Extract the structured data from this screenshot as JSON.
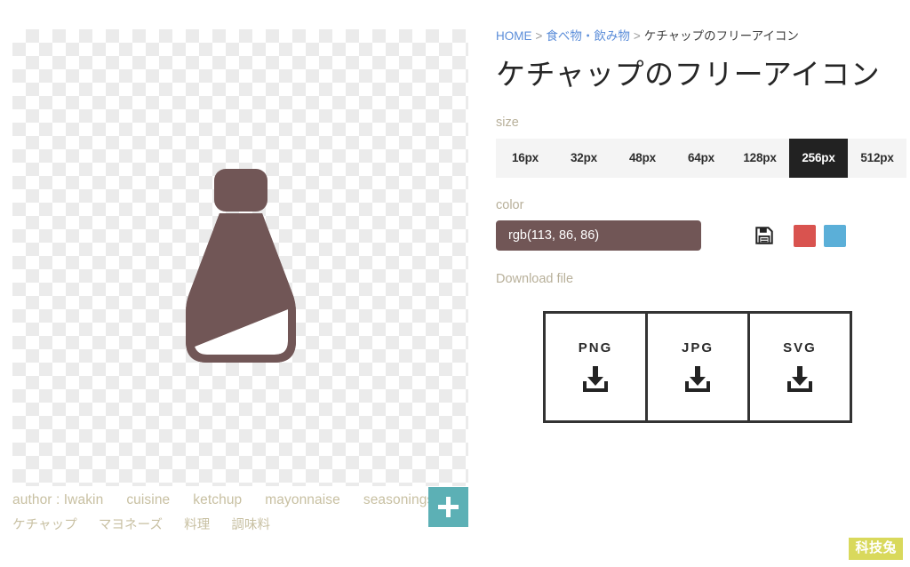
{
  "preview": {
    "icon_name": "ketchup-bottle-icon",
    "icon_color": "#715656",
    "canvas_background": "transparent-checkerboard"
  },
  "tags": {
    "row1": [
      {
        "name": "tag-author",
        "label": "author : Iwakin"
      },
      {
        "name": "tag-cuisine",
        "label": "cuisine"
      },
      {
        "name": "tag-ketchup",
        "label": "ketchup"
      },
      {
        "name": "tag-mayonnaise",
        "label": "mayonnaise"
      },
      {
        "name": "tag-seasonings",
        "label": "seasonings"
      }
    ],
    "row2": [
      {
        "name": "tag-ketchup-jp",
        "label": "ケチャップ"
      },
      {
        "name": "tag-mayonnaise-jp",
        "label": "マヨネーズ"
      },
      {
        "name": "tag-cuisine-jp",
        "label": "料理"
      },
      {
        "name": "tag-seasonings-jp",
        "label": "調味料"
      }
    ],
    "add_button_icon": "plus-icon",
    "add_button_color": "#5cb0b5"
  },
  "breadcrumb": {
    "home": "HOME",
    "separator": ">",
    "category": "食べ物・飲み物",
    "current": "ケチャップのフリーアイコン",
    "link_color": "#5b8dd9"
  },
  "title": "ケチャップのフリーアイコン",
  "size": {
    "label": "size",
    "options": [
      "16px",
      "32px",
      "48px",
      "64px",
      "128px",
      "256px",
      "512px"
    ],
    "selected": "256px",
    "active_background": "#222222"
  },
  "color": {
    "label": "color",
    "value": "rgb(113, 86, 86)",
    "placeholder": "rgb(113, 86, 86)",
    "field_background": "#715656",
    "save_icon": "floppy-disk-icon",
    "swatches": [
      {
        "name": "swatch-red",
        "color": "#d9534f"
      },
      {
        "name": "swatch-blue",
        "color": "#5bafd8"
      }
    ]
  },
  "download": {
    "label": "Download file",
    "buttons": [
      {
        "name": "download-png-button",
        "label": "PNG",
        "icon": "download-arrow-icon"
      },
      {
        "name": "download-jpg-button",
        "label": "JPG",
        "icon": "download-arrow-icon"
      },
      {
        "name": "download-svg-button",
        "label": "SVG",
        "icon": "download-arrow-icon"
      }
    ]
  },
  "watermark": {
    "text": "科技兔",
    "background": "#d9d95c"
  }
}
